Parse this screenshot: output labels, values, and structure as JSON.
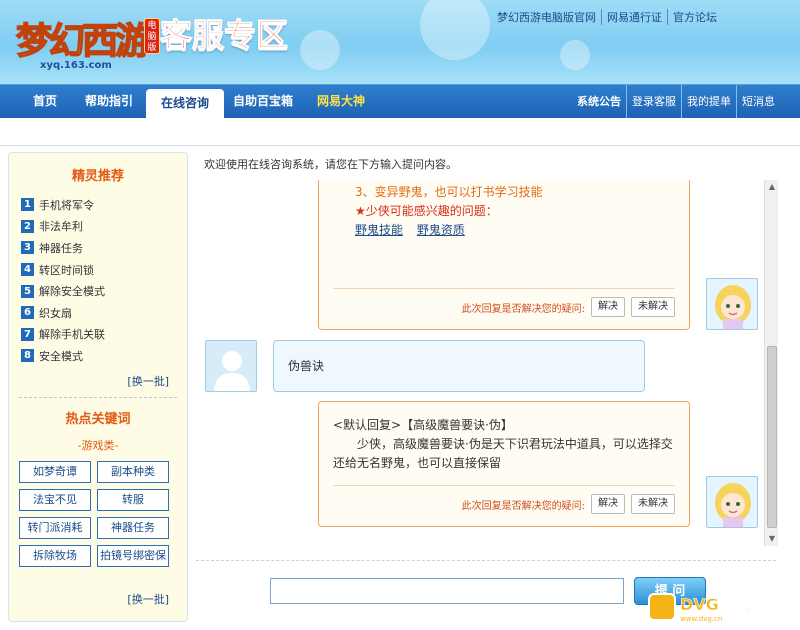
{
  "header": {
    "logo_text": "梦幻西游",
    "logo_badge": "电脑版",
    "logo_url": "xyq.163.com",
    "title": "客服专区",
    "top_links": [
      "梦幻西游电脑版官网",
      "网易通行证",
      "官方论坛"
    ]
  },
  "nav": {
    "items": [
      {
        "label": "首页",
        "active": false
      },
      {
        "label": "帮助指引",
        "active": false
      },
      {
        "label": "在线咨询",
        "active": true
      },
      {
        "label": "自助百宝箱",
        "active": false
      },
      {
        "label": "网易大神",
        "active": false
      }
    ],
    "right_links": [
      "系统公告",
      "登录客服",
      "我的提单",
      "短消息"
    ]
  },
  "sidebar": {
    "tips_title": "精灵推荐",
    "tips": [
      {
        "num": "1",
        "label": "手机将军令"
      },
      {
        "num": "2",
        "label": "非法牟利"
      },
      {
        "num": "3",
        "label": "神器任务"
      },
      {
        "num": "4",
        "label": "转区时间锁"
      },
      {
        "num": "5",
        "label": "解除安全模式"
      },
      {
        "num": "6",
        "label": "织女扇"
      },
      {
        "num": "7",
        "label": "解除手机关联"
      },
      {
        "num": "8",
        "label": "安全模式"
      }
    ],
    "refresh_label": "[换一批]",
    "keywords_title": "热点关键词",
    "keywords_category": "-游戏类-",
    "keywords": [
      "如梦奇谭",
      "副本种类",
      "法宝不见",
      "转服",
      "转门派消耗",
      "神器任务",
      "拆除牧场",
      "拍镜号绑密保"
    ],
    "keywords_refresh_label": "[换一批]"
  },
  "main": {
    "welcome": "欢迎使用在线咨询系统，请您在下方输入提问内容。",
    "msg1": {
      "line1": "3、变异野鬼，也可以打书学习技能",
      "line2": "★少侠可能感兴趣的问题：",
      "links": [
        "野鬼技能",
        "野鬼资质"
      ]
    },
    "feedback_label": "此次回复是否解决您的疑问:",
    "resolved_label": "解决",
    "unresolved_label": "未解决",
    "user_msg": "伪兽诀",
    "msg2": {
      "title": "<默认回复>【高级魔兽要诀·伪】",
      "body": "少侠，高级魔兽要诀·伪是天下识君玩法中道具，可以选择交还给无名野鬼，也可以直接保留"
    },
    "input_value": "",
    "ask_label": "提 问"
  },
  "watermark": {
    "text": "DVG游戏网",
    "sub": "www.dvg.cn"
  },
  "colors": {
    "nav_blue": "#1e62b5",
    "accent_orange": "#e36a14",
    "bot_border": "#f0a35a",
    "user_border": "#9fcbe3"
  }
}
